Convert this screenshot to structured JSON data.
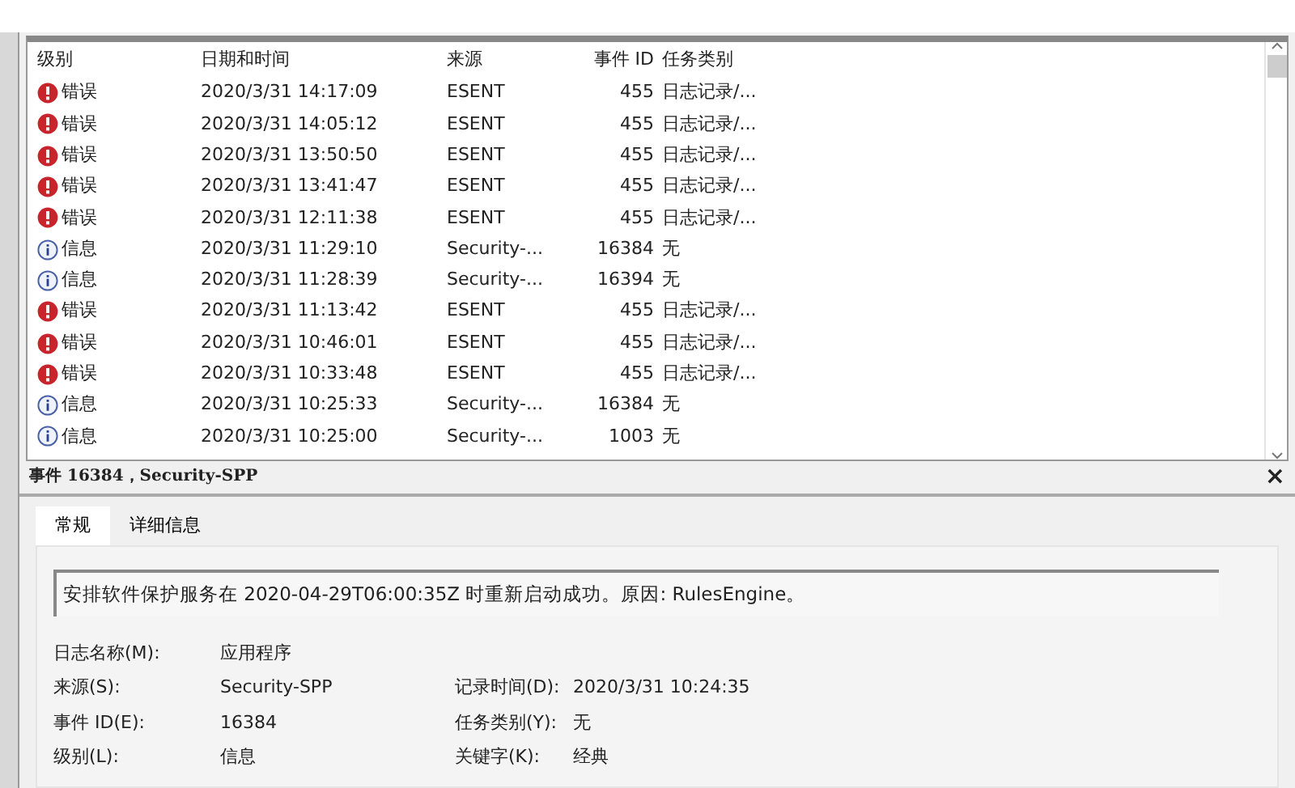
{
  "event_list": {
    "columns": [
      "级别",
      "日期和时间",
      "来源",
      "事件 ID",
      "任务类别"
    ],
    "rows": [
      {
        "kind": "error",
        "level": "错误",
        "date": "2020/3/31 14:17:09",
        "source": "ESENT",
        "event_id": "455",
        "task": "日志记录/..."
      },
      {
        "kind": "error",
        "level": "错误",
        "date": "2020/3/31 14:05:12",
        "source": "ESENT",
        "event_id": "455",
        "task": "日志记录/..."
      },
      {
        "kind": "error",
        "level": "错误",
        "date": "2020/3/31 13:50:50",
        "source": "ESENT",
        "event_id": "455",
        "task": "日志记录/..."
      },
      {
        "kind": "error",
        "level": "错误",
        "date": "2020/3/31 13:41:47",
        "source": "ESENT",
        "event_id": "455",
        "task": "日志记录/..."
      },
      {
        "kind": "error",
        "level": "错误",
        "date": "2020/3/31 12:11:38",
        "source": "ESENT",
        "event_id": "455",
        "task": "日志记录/..."
      },
      {
        "kind": "info",
        "level": "信息",
        "date": "2020/3/31 11:29:10",
        "source": "Security-...",
        "event_id": "16384",
        "task": "无"
      },
      {
        "kind": "info",
        "level": "信息",
        "date": "2020/3/31 11:28:39",
        "source": "Security-...",
        "event_id": "16394",
        "task": "无"
      },
      {
        "kind": "error",
        "level": "错误",
        "date": "2020/3/31 11:13:42",
        "source": "ESENT",
        "event_id": "455",
        "task": "日志记录/..."
      },
      {
        "kind": "error",
        "level": "错误",
        "date": "2020/3/31 10:46:01",
        "source": "ESENT",
        "event_id": "455",
        "task": "日志记录/..."
      },
      {
        "kind": "error",
        "level": "错误",
        "date": "2020/3/31 10:33:48",
        "source": "ESENT",
        "event_id": "455",
        "task": "日志记录/..."
      },
      {
        "kind": "info",
        "level": "信息",
        "date": "2020/3/31 10:25:33",
        "source": "Security-...",
        "event_id": "16384",
        "task": "无"
      },
      {
        "kind": "info",
        "level": "信息",
        "date": "2020/3/31 10:25:00",
        "source": "Security-...",
        "event_id": "1003",
        "task": "无"
      }
    ]
  },
  "details": {
    "title": "事件 16384，Security-SPP",
    "close": "×",
    "tabs": [
      {
        "label": "常规",
        "selected": true
      },
      {
        "label": "详细信息",
        "selected": false
      }
    ],
    "message": "安排软件保护服务在 2020-04-29T06:00:35Z 时重新启动成功。原因: RulesEngine。",
    "fields": [
      {
        "label": "日志名称(M):",
        "value": "应用程序"
      },
      {
        "label": "来源(S):",
        "value": "Security-SPP",
        "label_2": "记录时间(D):",
        "value_2": "2020/3/31 10:24:35"
      },
      {
        "label": "事件 ID(E):",
        "value": "16384",
        "label_2": "任务类别(Y):",
        "value_2": "无"
      },
      {
        "label": "级别(L):",
        "value": "信息",
        "label_2": "关键字(K):",
        "value_2": "经典"
      }
    ]
  }
}
